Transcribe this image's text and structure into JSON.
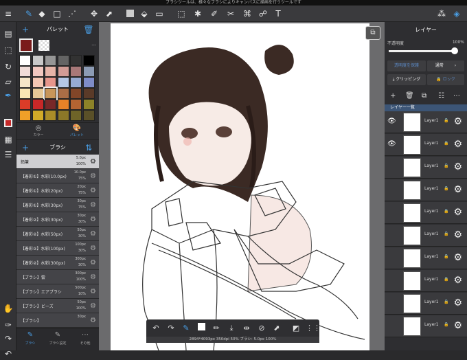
{
  "status_message": "ブラシツールは、様々なブラシによりキャンバスに描画を行うツールです",
  "top_toolbar": {
    "icons": [
      "menu-icon",
      "brush-icon",
      "eraser-icon",
      "rect-icon",
      "pen-select-icon",
      "move-icon",
      "transform-icon",
      "fill-color-icon",
      "bucket-icon",
      "gradient-icon",
      "select-rect-icon",
      "magic-wand-icon",
      "select-pen-icon",
      "select-eraser-icon",
      "hand-icon",
      "text-icon",
      "materials-icon",
      "layers-icon"
    ]
  },
  "palette": {
    "title": "パレット",
    "more": "---",
    "tabs": [
      {
        "label": "カラー"
      },
      {
        "label": "パレット"
      }
    ],
    "colors": [
      "#ffffff",
      "#c8c8c8",
      "#969696",
      "#646464",
      "#323232",
      "#000000",
      "#f0dcd8",
      "#f2c8c0",
      "#e6b4a8",
      "#d29c96",
      "#a87878",
      "#8c9bb4",
      "#f5e6c8",
      "#f5c8b4",
      "#e6968c",
      "#b4c8e6",
      "#96aad2",
      "#7e8cc8",
      "#fae6b4",
      "#e6c896",
      "#c8965a",
      "#aa6e46",
      "#824628",
      "#5a3a28",
      "#dc3c28",
      "#c82828",
      "#782828",
      "#e68228",
      "#b46432",
      "#8c8228",
      "#f0a028",
      "#d2aa28",
      "#aa8c28",
      "#8c7828",
      "#6e6428",
      "#5a5028"
    ]
  },
  "brush": {
    "title": "ブラシ",
    "items": [
      {
        "name": "鉛筆",
        "size": "5.0px",
        "opacity": "100%"
      },
      {
        "name": "【着彩①】水彩(10.0px)",
        "size": "10.0px",
        "opacity": "75%"
      },
      {
        "name": "【着彩①】水彩(20px)",
        "size": "20px",
        "opacity": "75%"
      },
      {
        "name": "【着彩①】水彩(30px)",
        "size": "30px",
        "opacity": "75%"
      },
      {
        "name": "【着彩②】水彩(30px)",
        "size": "30px",
        "opacity": "30%"
      },
      {
        "name": "【着彩②】水彩(50px)",
        "size": "50px",
        "opacity": "30%"
      },
      {
        "name": "【着彩②】水彩(100px)",
        "size": "100px",
        "opacity": "30%"
      },
      {
        "name": "【着彩②】水彩(300px)",
        "size": "300px",
        "opacity": "30%"
      },
      {
        "name": "【ブラシ】雲",
        "size": "300px",
        "opacity": "100%"
      },
      {
        "name": "【ブラシ】エアブラシ",
        "size": "500px",
        "opacity": "10%"
      },
      {
        "name": "【ブラシ】ビーズ",
        "size": "50px",
        "opacity": "100%"
      },
      {
        "name": "【ブラシ】",
        "size": "30px",
        "opacity": ""
      }
    ],
    "bottom_tabs": [
      {
        "label": "ブラシ"
      },
      {
        "label": "ブラシ設定"
      },
      {
        "label": "その他"
      }
    ]
  },
  "layers_panel": {
    "title": "レイヤー",
    "opacity_label": "不透明度",
    "opacity_value": "100%",
    "opacity_fraction": 1.0,
    "protect_label": "透明度を保護",
    "blend_mode": "通常",
    "clipping_label": "クリッピング",
    "lock_label": "ロック",
    "list_label": "レイヤー一覧",
    "layers": [
      {
        "name": "Layer1",
        "visible": true
      },
      {
        "name": "Layer1",
        "visible": true
      },
      {
        "name": "Layer1",
        "visible": false
      },
      {
        "name": "Layer1",
        "visible": false
      },
      {
        "name": "Layer1",
        "visible": false
      },
      {
        "name": "Layer1",
        "visible": false
      },
      {
        "name": "Layer1",
        "visible": false
      },
      {
        "name": "Layer1",
        "visible": false
      },
      {
        "name": "Layer1",
        "visible": false
      },
      {
        "name": "Layer1",
        "visible": false
      }
    ]
  },
  "info_bar": "2894*4093px 350dpi 50% ブラシ: 5.0px 100%"
}
